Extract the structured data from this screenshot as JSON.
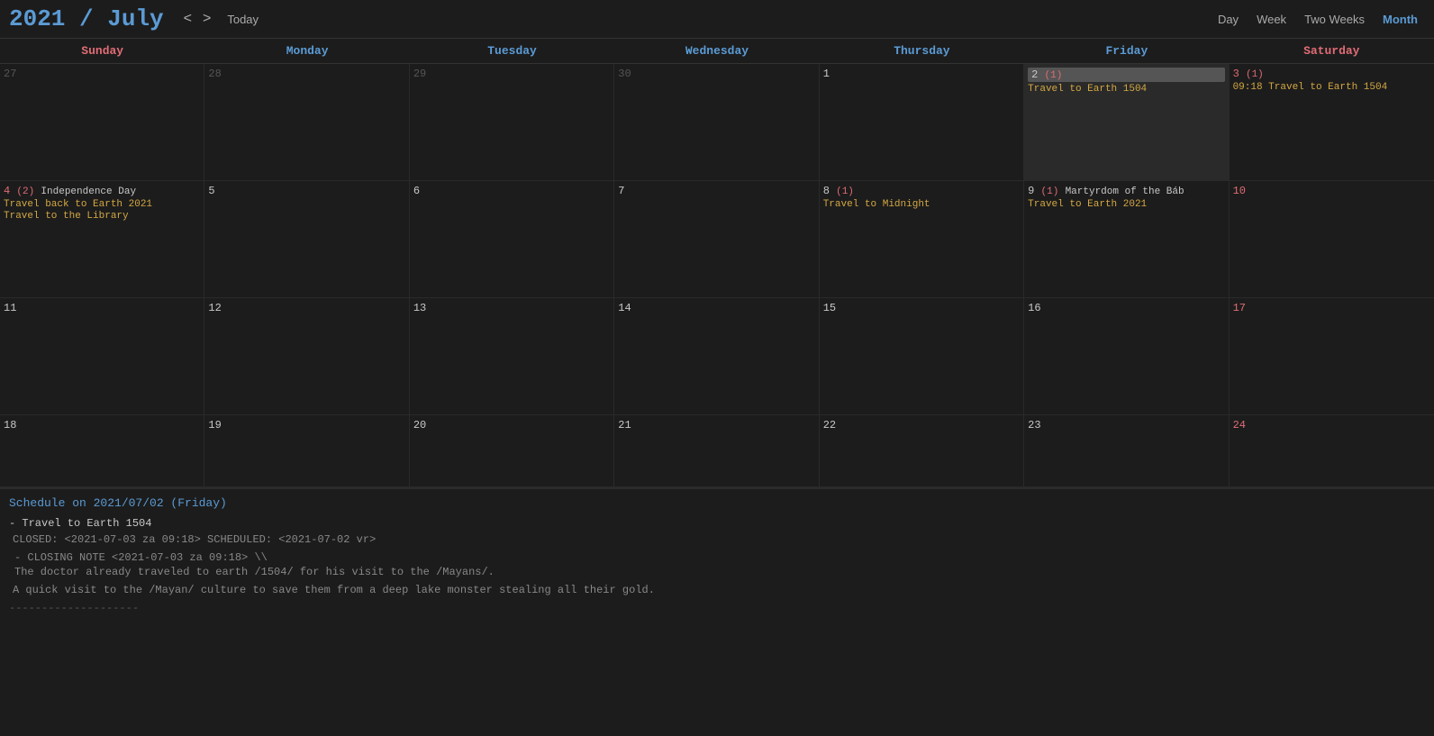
{
  "header": {
    "year": "2021",
    "slash": " / ",
    "month": "July",
    "nav_prev": "<",
    "nav_next": ">",
    "today_label": "Today",
    "views": [
      "Day",
      "Week",
      "Two Weeks",
      "Month"
    ],
    "active_view": "Month"
  },
  "days_of_week": [
    {
      "label": "Sunday",
      "class": "sun"
    },
    {
      "label": "Monday",
      "class": "mon"
    },
    {
      "label": "Tuesday",
      "class": "tue"
    },
    {
      "label": "Wednesday",
      "class": "wed"
    },
    {
      "label": "Thursday",
      "class": "thu"
    },
    {
      "label": "Friday",
      "class": "fri"
    },
    {
      "label": "Saturday",
      "class": "sat"
    }
  ],
  "schedule": {
    "title": "Schedule on 2021/07/02 (Friday)",
    "item1_title": "- Travel to Earth 1504",
    "item1_closed": "CLOSED: <2021-07-03 za 09:18> SCHEDULED: <2021-07-02 vr>",
    "item1_closing_note_label": "- CLOSING NOTE <2021-07-03 za 09:18> \\\\",
    "item1_note_line1": "  The doctor already traveled to earth /1504/ for his visit to the /Mayans/.",
    "item1_desc": "A quick visit to the /Mayan/ culture to save them from a deep lake monster stealing all their gold.",
    "separator": "--------------------"
  }
}
